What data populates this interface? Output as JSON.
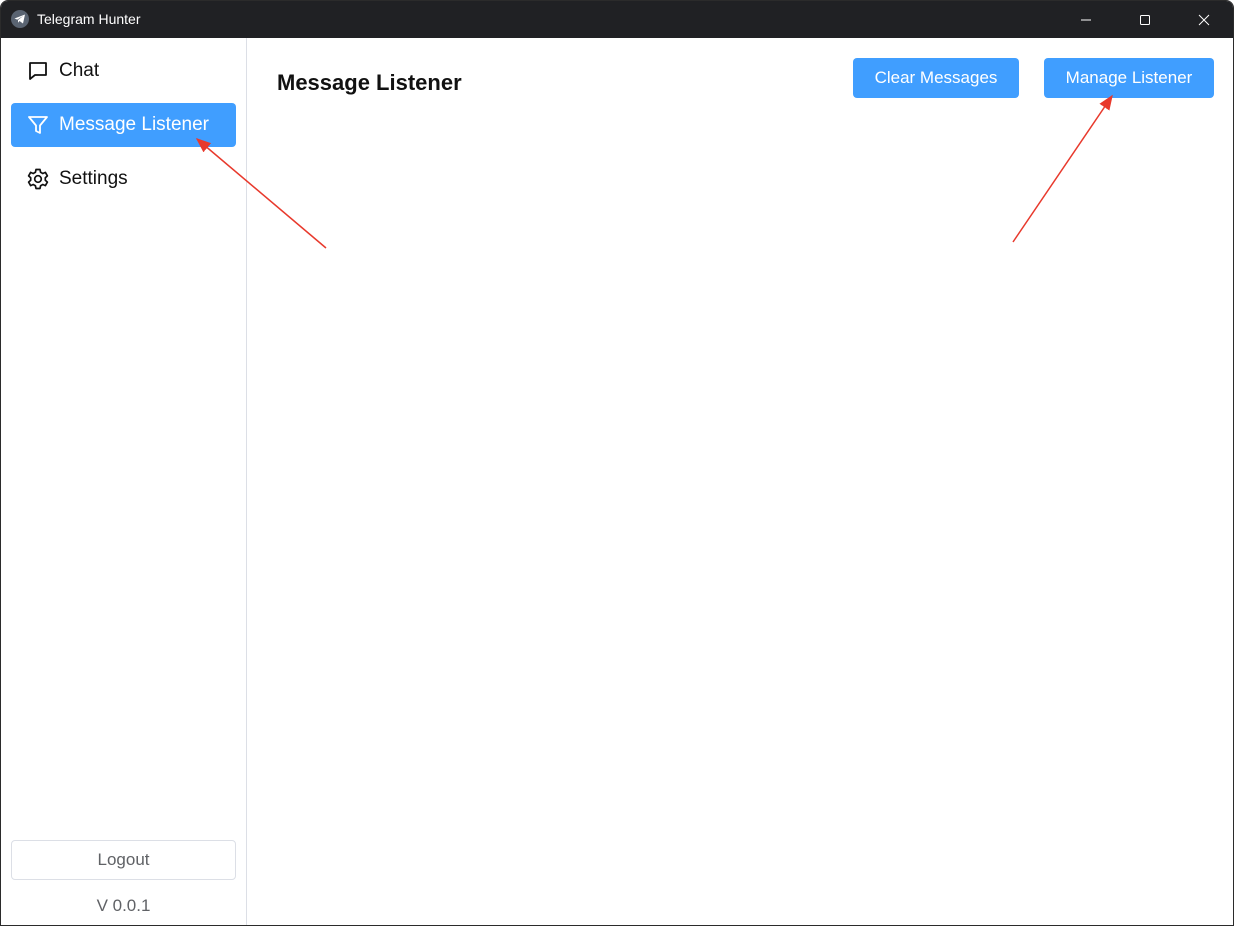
{
  "window": {
    "title": "Telegram Hunter",
    "logo_icon": "telegram-plane-icon",
    "controls": [
      "minimize-icon",
      "maximize-icon",
      "close-icon"
    ]
  },
  "sidebar": {
    "items": [
      {
        "label": "Chat",
        "icon": "chat-bubble-icon",
        "active": false
      },
      {
        "label": "Message Listener",
        "icon": "filter-icon",
        "active": true
      },
      {
        "label": "Settings",
        "icon": "gear-icon",
        "active": false
      }
    ],
    "logout_label": "Logout",
    "version": "V 0.0.1"
  },
  "main": {
    "title": "Message Listener",
    "buttons": {
      "clear": "Clear Messages",
      "manage": "Manage Listener"
    }
  },
  "colors": {
    "accent": "#409eff",
    "titlebar": "#202124",
    "annotation_arrow": "#e8392c"
  }
}
